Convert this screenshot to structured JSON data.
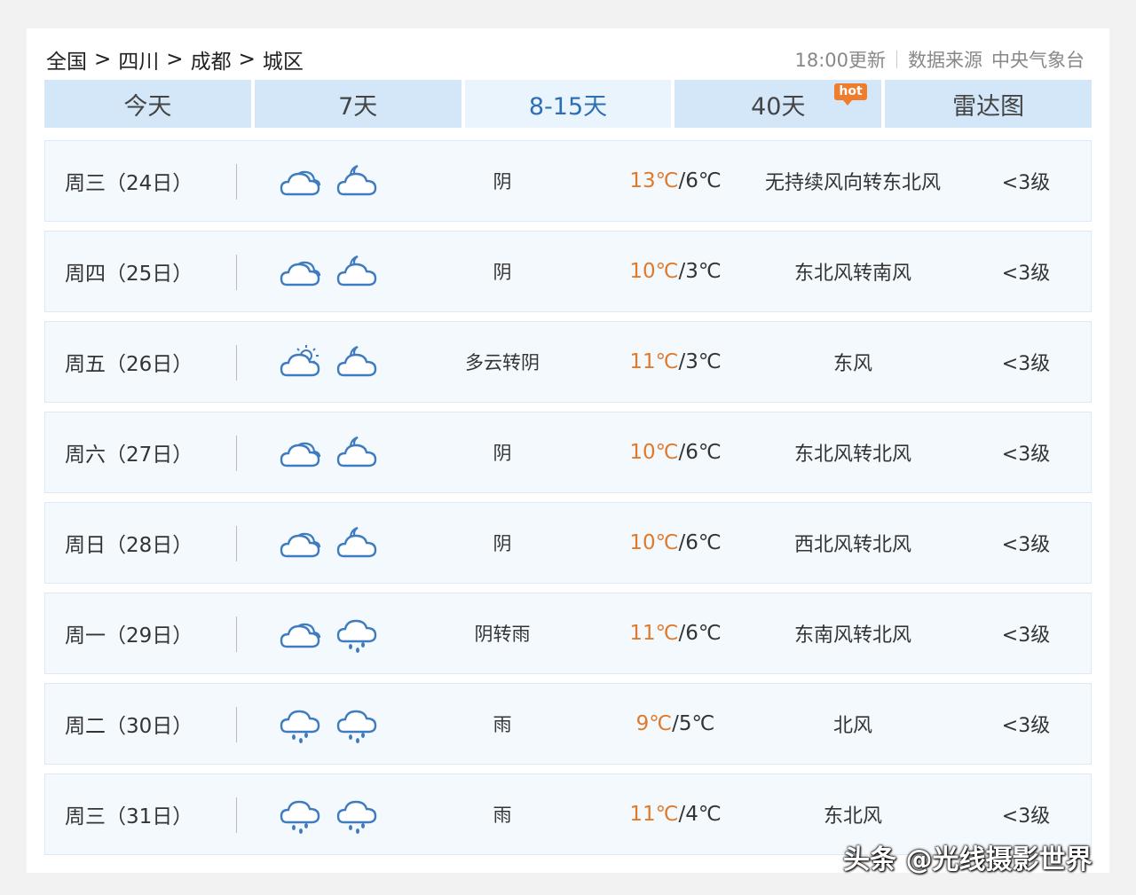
{
  "breadcrumb": [
    "全国",
    "四川",
    "成都",
    "城区"
  ],
  "breadcrumb_sep": ">",
  "update": {
    "time_label": "18:00更新",
    "source_label": "数据来源",
    "source_name": "中央气象台"
  },
  "tabs": [
    {
      "label": "今天"
    },
    {
      "label": "7天"
    },
    {
      "label": "8-15天",
      "active": true
    },
    {
      "label": "40天",
      "badge": "hot"
    },
    {
      "label": "雷达图"
    }
  ],
  "days": [
    {
      "date": "周三（24日）",
      "icons": [
        "cloud-icon",
        "cloud-moon-icon"
      ],
      "cond": "阴",
      "hi": "13℃",
      "lo": "6℃",
      "wind": "无持续风向转东北风",
      "level": "<3级"
    },
    {
      "date": "周四（25日）",
      "icons": [
        "cloud-icon",
        "cloud-moon-icon"
      ],
      "cond": "阴",
      "hi": "10℃",
      "lo": "3℃",
      "wind": "东北风转南风",
      "level": "<3级"
    },
    {
      "date": "周五（26日）",
      "icons": [
        "cloud-sun-icon",
        "cloud-moon-icon"
      ],
      "cond": "多云转阴",
      "hi": "11℃",
      "lo": "3℃",
      "wind": "东风",
      "level": "<3级"
    },
    {
      "date": "周六（27日）",
      "icons": [
        "cloud-icon",
        "cloud-moon-icon"
      ],
      "cond": "阴",
      "hi": "10℃",
      "lo": "6℃",
      "wind": "东北风转北风",
      "level": "<3级"
    },
    {
      "date": "周日（28日）",
      "icons": [
        "cloud-icon",
        "cloud-moon-icon"
      ],
      "cond": "阴",
      "hi": "10℃",
      "lo": "6℃",
      "wind": "西北风转北风",
      "level": "<3级"
    },
    {
      "date": "周一（29日）",
      "icons": [
        "cloud-icon",
        "rain-icon"
      ],
      "cond": "阴转雨",
      "hi": "11℃",
      "lo": "6℃",
      "wind": "东南风转北风",
      "level": "<3级"
    },
    {
      "date": "周二（30日）",
      "icons": [
        "rain-icon",
        "rain-icon"
      ],
      "cond": "雨",
      "hi": "9℃",
      "lo": "5℃",
      "wind": "北风",
      "level": "<3级"
    },
    {
      "date": "周三（31日）",
      "icons": [
        "rain-icon",
        "rain-icon"
      ],
      "cond": "雨",
      "hi": "11℃",
      "lo": "4℃",
      "wind": "东北风",
      "level": "<3级"
    }
  ],
  "colors": {
    "tab_bg": "#d3e7f8",
    "tab_active_bg": "#eaf4fd",
    "tab_active_text": "#2e6eb5",
    "row_bg": "#f4f9fe",
    "high_temp": "#e07a2b",
    "hot_badge": "#f07c2e",
    "icon_stroke": "#3f7cbf"
  },
  "watermark": "头条 @光线摄影世界"
}
